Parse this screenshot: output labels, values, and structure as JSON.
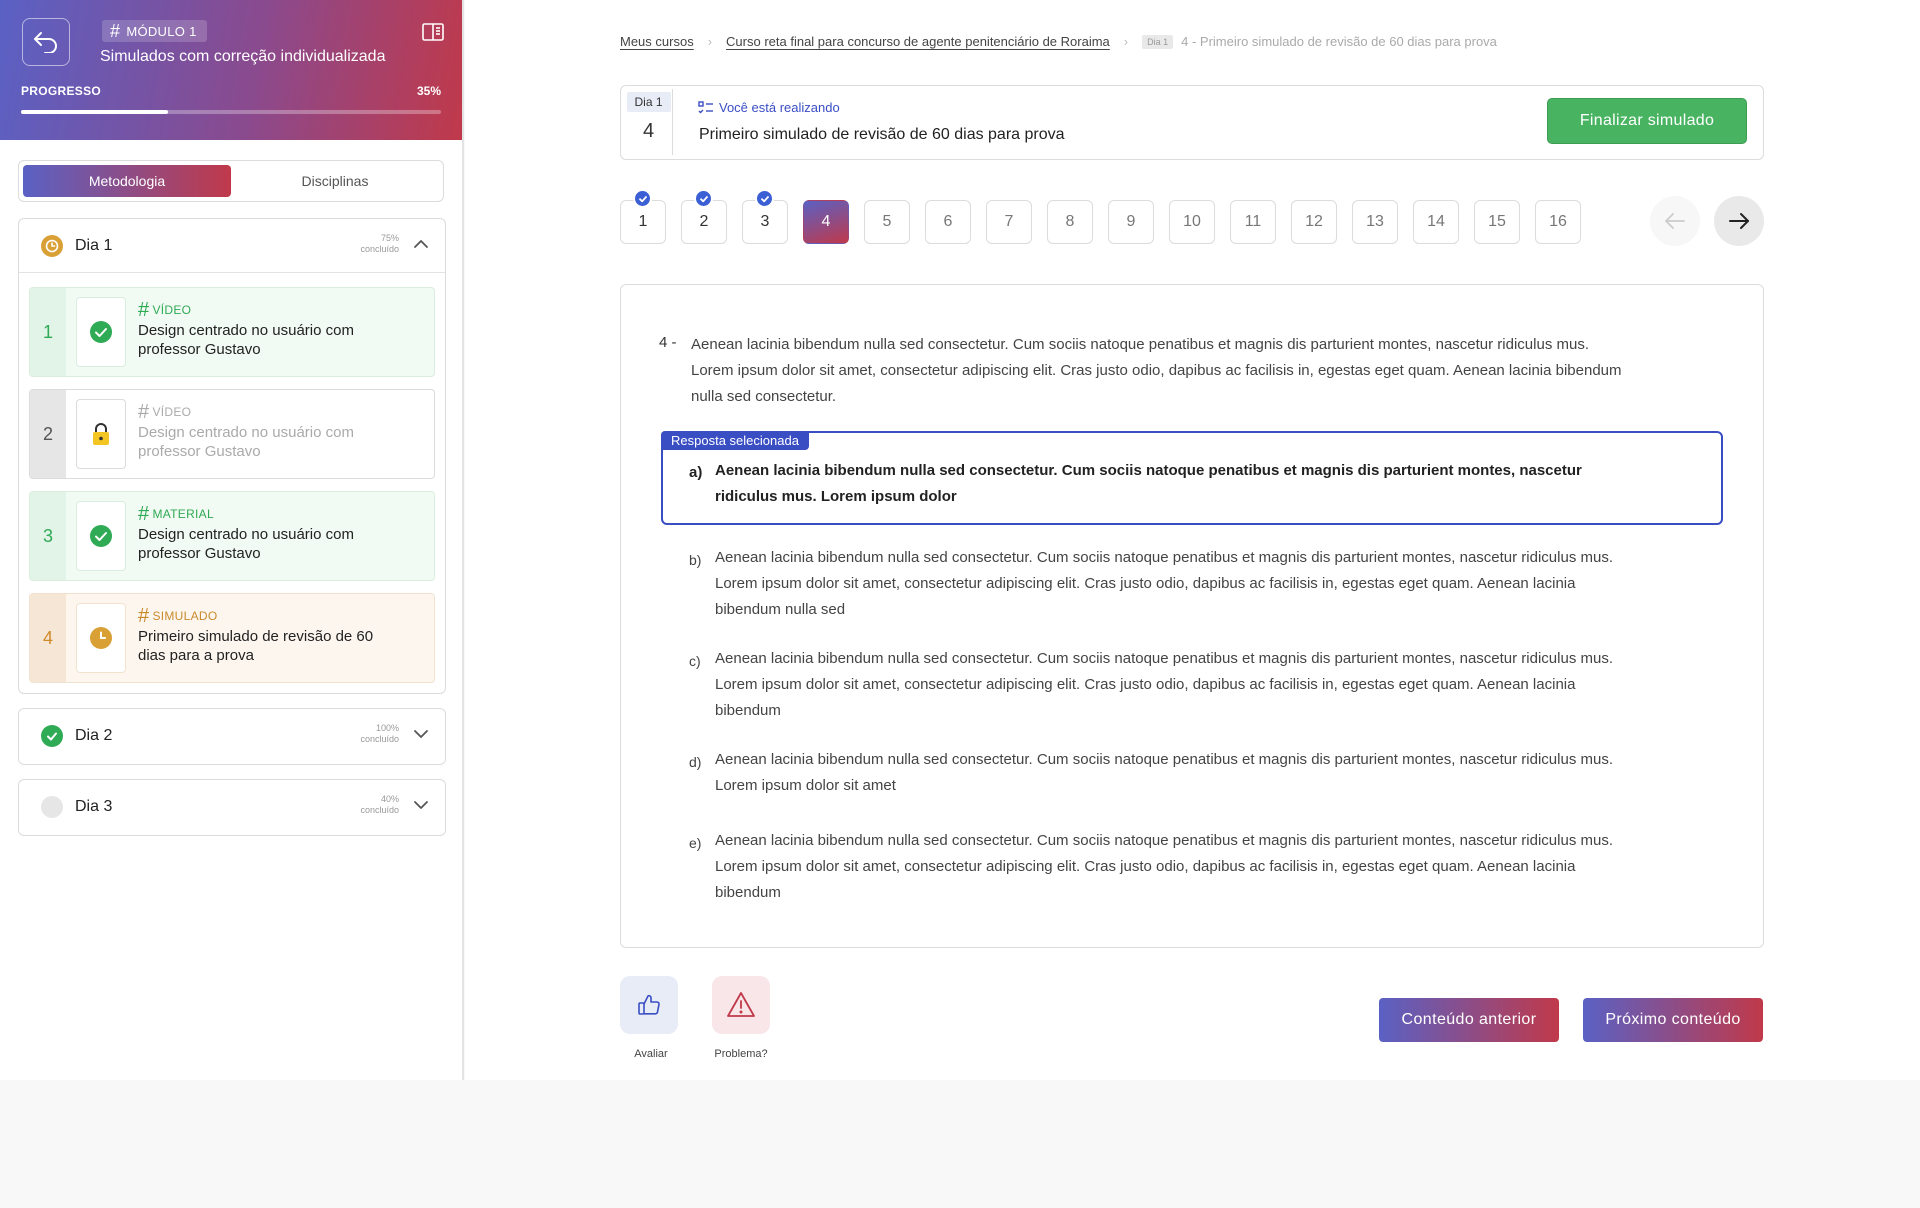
{
  "sidebar": {
    "module_tag": "MÓDULO 1",
    "module_title": "Simulados com correção individualizada",
    "progress_label": "PROGRESSO",
    "progress_percent": "35%",
    "progress_value": 0.35,
    "tabs": [
      {
        "label": "Metodologia",
        "active": true
      },
      {
        "label": "Disciplinas",
        "active": false
      }
    ],
    "days": [
      {
        "title": "Dia 1",
        "percent": "75%",
        "status_word": "concluído",
        "status": "in-progress",
        "expanded": true,
        "lessons": [
          {
            "num": "1",
            "type": "VÍDEO",
            "title": "Design centrado no usuário com professor Gustavo",
            "state": "done"
          },
          {
            "num": "2",
            "type": "VÍDEO",
            "title": "Design centrado no usuário com professor Gustavo",
            "state": "locked"
          },
          {
            "num": "3",
            "type": "MATERIAL",
            "title": "Design centrado no usuário com professor Gustavo",
            "state": "done"
          },
          {
            "num": "4",
            "type": "SIMULADO",
            "title": "Primeiro simulado de revisão de 60 dias para a prova",
            "state": "current"
          }
        ]
      },
      {
        "title": "Dia 2",
        "percent": "100%",
        "status_word": "concluído",
        "status": "done",
        "expanded": false
      },
      {
        "title": "Dia 3",
        "percent": "40%",
        "status_word": "concluído",
        "status": "empty",
        "expanded": false
      }
    ]
  },
  "breadcrumb": {
    "items": [
      "Meus cursos",
      "Curso reta final para concurso de agente penitenciário de Roraima"
    ],
    "day_badge": "Dia 1",
    "current": "4 - Primeiro simulado de revisão de 60 dias para prova"
  },
  "simulado": {
    "day_label": "Dia 1",
    "day_number": "4",
    "doing_label": "Você está realizando",
    "title": "Primeiro simulado de revisão de 60 dias para prova",
    "finish_label": "Finalizar simulado"
  },
  "question_nav": {
    "questions": [
      {
        "label": "1",
        "state": "done"
      },
      {
        "label": "2",
        "state": "done"
      },
      {
        "label": "3",
        "state": "done"
      },
      {
        "label": "4",
        "state": "active"
      },
      {
        "label": "5",
        "state": "pending"
      },
      {
        "label": "6",
        "state": "pending"
      },
      {
        "label": "7",
        "state": "pending"
      },
      {
        "label": "8",
        "state": "pending"
      },
      {
        "label": "9",
        "state": "pending"
      },
      {
        "label": "10",
        "state": "pending"
      },
      {
        "label": "11",
        "state": "pending"
      },
      {
        "label": "12",
        "state": "pending"
      },
      {
        "label": "13",
        "state": "pending"
      },
      {
        "label": "14",
        "state": "pending"
      },
      {
        "label": "15",
        "state": "pending"
      },
      {
        "label": "16",
        "state": "pending"
      }
    ]
  },
  "question": {
    "number": "4 -",
    "text": "Aenean lacinia bibendum nulla sed consectetur. Cum sociis natoque penatibus et magnis dis parturient montes, nascetur ridiculus mus. Lorem ipsum dolor sit amet, consectetur adipiscing elit. Cras justo odio, dapibus ac facilisis in, egestas eget quam. Aenean lacinia bibendum nulla sed consectetur.",
    "selected_label": "Resposta selecionada",
    "options": [
      {
        "letter": "a)",
        "text": "Aenean lacinia bibendum nulla sed consectetur. Cum sociis natoque penatibus et magnis dis parturient montes, nascetur ridiculus mus. Lorem ipsum dolor",
        "selected": true
      },
      {
        "letter": "b)",
        "text": "Aenean lacinia bibendum nulla sed consectetur. Cum sociis natoque penatibus et magnis dis parturient montes, nascetur ridiculus mus. Lorem ipsum dolor sit amet, consectetur adipiscing elit. Cras justo odio, dapibus ac facilisis in, egestas eget quam. Aenean lacinia bibendum nulla sed",
        "selected": false
      },
      {
        "letter": "c)",
        "text": "Aenean lacinia bibendum nulla sed consectetur. Cum sociis natoque penatibus et magnis dis parturient montes, nascetur ridiculus mus. Lorem ipsum dolor sit amet, consectetur adipiscing elit. Cras justo odio, dapibus ac facilisis in, egestas eget quam. Aenean lacinia bibendum",
        "selected": false
      },
      {
        "letter": "d)",
        "text": "Aenean lacinia bibendum nulla sed consectetur. Cum sociis natoque penatibus et magnis dis parturient montes, nascetur ridiculus mus. Lorem ipsum dolor sit amet",
        "selected": false
      },
      {
        "letter": "e)",
        "text": "Aenean lacinia bibendum nulla sed consectetur. Cum sociis natoque penatibus et magnis dis parturient montes, nascetur ridiculus mus. Lorem ipsum dolor sit amet, consectetur adipiscing elit. Cras justo odio, dapibus ac facilisis in, egestas eget quam. Aenean lacinia bibendum",
        "selected": false
      }
    ]
  },
  "feedback": {
    "rate_label": "Avaliar",
    "problem_label": "Problema?"
  },
  "footer_nav": {
    "prev_label": "Conteúdo anterior",
    "next_label": "Próximo conteúdo"
  },
  "colors": {
    "accent_blue": "#3a4ec4",
    "gradient_start": "#5a61c4",
    "gradient_end": "#c0394a",
    "success": "#48b461",
    "warning": "#d9a035"
  },
  "icons": {
    "back": "back-arrow-icon",
    "book": "book-icon",
    "check": "check-icon",
    "clock": "clock-icon",
    "lock": "lock-icon",
    "chevron_up": "chevron-up-icon",
    "chevron_down": "chevron-down-icon",
    "list": "list-check-icon",
    "arrow_left": "arrow-left-icon",
    "arrow_right": "arrow-right-icon",
    "thumbs_up": "thumbs-up-icon",
    "warning": "warning-icon"
  }
}
